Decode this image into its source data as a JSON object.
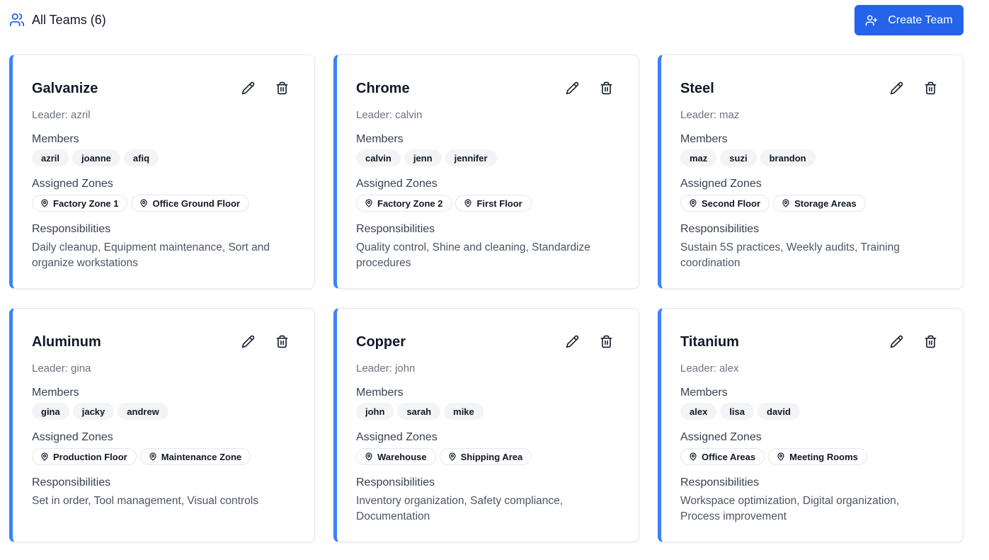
{
  "header": {
    "title": "All Teams (6)",
    "title_icon": "users-icon",
    "create_button_label": "Create Team",
    "create_button_icon": "user-plus-icon"
  },
  "labels": {
    "leader_prefix": "Leader: ",
    "members": "Members",
    "zones": "Assigned Zones",
    "responsibilities": "Responsibilities"
  },
  "colors": {
    "primary": "#2563eb",
    "card_accent": "#3b82f6"
  },
  "teams": [
    {
      "name": "Galvanize",
      "leader": "Leader: azril",
      "members": [
        "azril",
        "joanne",
        "afiq"
      ],
      "zones": [
        "Factory Zone 1",
        "Office Ground Floor"
      ],
      "responsibilities": "Daily cleanup, Equipment maintenance, Sort and organize workstations"
    },
    {
      "name": "Chrome",
      "leader": "Leader: calvin",
      "members": [
        "calvin",
        "jenn",
        "jennifer"
      ],
      "zones": [
        "Factory Zone 2",
        "First Floor"
      ],
      "responsibilities": "Quality control, Shine and cleaning, Standardize procedures"
    },
    {
      "name": "Steel",
      "leader": "Leader: maz",
      "members": [
        "maz",
        "suzi",
        "brandon"
      ],
      "zones": [
        "Second Floor",
        "Storage Areas"
      ],
      "responsibilities": "Sustain 5S practices, Weekly audits, Training coordination"
    },
    {
      "name": "Aluminum",
      "leader": "Leader: gina",
      "members": [
        "gina",
        "jacky",
        "andrew"
      ],
      "zones": [
        "Production Floor",
        "Maintenance Zone"
      ],
      "responsibilities": "Set in order, Tool management, Visual controls"
    },
    {
      "name": "Copper",
      "leader": "Leader: john",
      "members": [
        "john",
        "sarah",
        "mike"
      ],
      "zones": [
        "Warehouse",
        "Shipping Area"
      ],
      "responsibilities": "Inventory organization, Safety compliance, Documentation"
    },
    {
      "name": "Titanium",
      "leader": "Leader: alex",
      "members": [
        "alex",
        "lisa",
        "david"
      ],
      "zones": [
        "Office Areas",
        "Meeting Rooms"
      ],
      "responsibilities": "Workspace optimization, Digital organization, Process improvement"
    }
  ]
}
